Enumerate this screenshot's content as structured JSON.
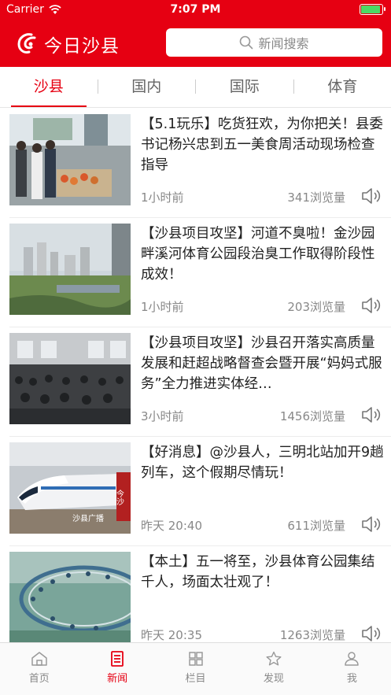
{
  "status_bar": {
    "carrier": "Carrier",
    "time": "7:07 PM"
  },
  "header": {
    "app_title": "今日沙县",
    "search_placeholder": "新闻搜索"
  },
  "tabs": [
    {
      "label": "沙县",
      "active": true
    },
    {
      "label": "国内",
      "active": false
    },
    {
      "label": "国际",
      "active": false
    },
    {
      "label": "体育",
      "active": false
    }
  ],
  "news": [
    {
      "title": "【5.1玩乐】吃货狂欢，为你把关！县委书记杨兴忠到五一美食周活动现场检查指导",
      "time": "1小时前",
      "views": "341浏览量"
    },
    {
      "title": "【沙县项目攻坚】河道不臭啦！金沙园畔溪河体育公园段治臭工作取得阶段性成效！",
      "time": "1小时前",
      "views": "203浏览量"
    },
    {
      "title": "【沙县项目攻坚】沙县召开落实高质量发展和赶超战略督查会暨开展“妈妈式服务”全力推进实体经…",
      "time": "3小时前",
      "views": "1456浏览量"
    },
    {
      "title": "【好消息】@沙县人，三明北站加开9趟列车，这个假期尽情玩！",
      "time": "昨天 20:40",
      "views": "611浏览量",
      "thumb_caption": "沙县广播",
      "thumb_logo": "今沙"
    },
    {
      "title": "【本土】五一将至，沙县体育公园集结千人，场面太壮观了！",
      "time": "昨天 20:35",
      "views": "1263浏览量"
    }
  ],
  "tabbar": [
    {
      "label": "首页",
      "icon": "home-icon",
      "active": false
    },
    {
      "label": "新闻",
      "icon": "news-icon",
      "active": true
    },
    {
      "label": "栏目",
      "icon": "grid-icon",
      "active": false
    },
    {
      "label": "发现",
      "icon": "discover-star-icon",
      "active": false
    },
    {
      "label": "我",
      "icon": "user-icon",
      "active": false
    }
  ],
  "colors": {
    "brand_red": "#e60012",
    "battery_green": "#4cd964",
    "text_gray": "#888888"
  }
}
